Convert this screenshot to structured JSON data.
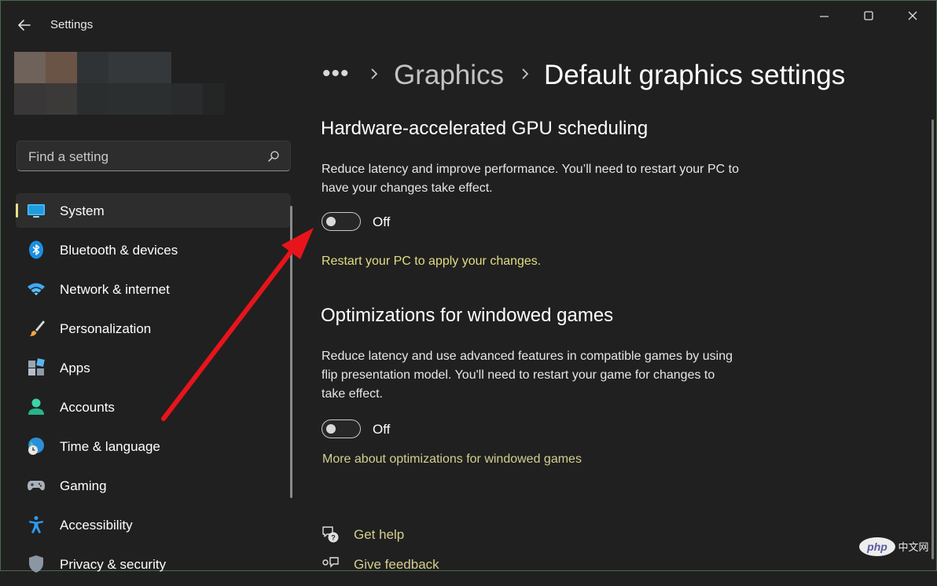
{
  "window": {
    "app_title": "Settings"
  },
  "search": {
    "placeholder": "Find a setting"
  },
  "sidebar": {
    "items": [
      {
        "label": "System",
        "icon": "system-icon",
        "selected": true
      },
      {
        "label": "Bluetooth & devices",
        "icon": "bluetooth-icon"
      },
      {
        "label": "Network & internet",
        "icon": "wifi-icon"
      },
      {
        "label": "Personalization",
        "icon": "brush-icon"
      },
      {
        "label": "Apps",
        "icon": "apps-icon"
      },
      {
        "label": "Accounts",
        "icon": "accounts-icon"
      },
      {
        "label": "Time & language",
        "icon": "globe-clock-icon"
      },
      {
        "label": "Gaming",
        "icon": "gamepad-icon"
      },
      {
        "label": "Accessibility",
        "icon": "accessibility-icon"
      },
      {
        "label": "Privacy & security",
        "icon": "shield-icon"
      }
    ]
  },
  "breadcrumb": {
    "more": "•••",
    "parent": "Graphics",
    "current": "Default graphics settings"
  },
  "gpu_scheduling": {
    "title": "Hardware-accelerated GPU scheduling",
    "description": "Reduce latency and improve performance. You’ll need to restart your PC to have your changes take effect.",
    "toggle_state": "Off",
    "restart_notice": "Restart your PC to apply your changes."
  },
  "windowed_games": {
    "title": "Optimizations for windowed games",
    "description": "Reduce latency and use advanced features in compatible games by using flip presentation model. You'll need to restart your game for changes to take effect.",
    "toggle_state": "Off",
    "more_link": "More about optimizations for windowed games"
  },
  "help": {
    "get_help": "Get help",
    "give_feedback": "Give feedback"
  },
  "watermark": {
    "text": "php中文网"
  },
  "colors": {
    "background": "#202020",
    "accent_link": "#e3dc83",
    "selected_bar": "#e6e08a",
    "annotation_arrow": "#e8141b"
  }
}
